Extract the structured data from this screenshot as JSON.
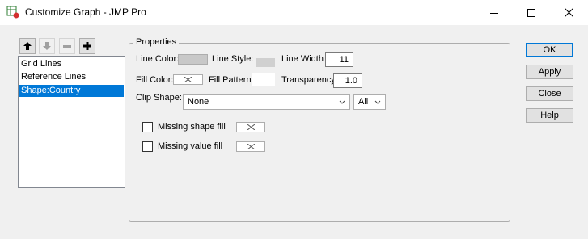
{
  "window": {
    "title": "Customize Graph - JMP Pro",
    "icon": "jmp-app-icon",
    "controls": [
      "minimize-icon",
      "maximize-icon",
      "close-icon"
    ]
  },
  "toolbar": {
    "buttons": [
      {
        "icon": "arrow-up-icon",
        "enabled": true
      },
      {
        "icon": "arrow-down-icon",
        "enabled": false
      },
      {
        "icon": "minus-icon",
        "enabled": false
      },
      {
        "icon": "plus-icon",
        "enabled": true
      }
    ]
  },
  "list": {
    "items": [
      "Grid Lines",
      "Reference Lines",
      "Shape:Country"
    ],
    "selected_index": 2
  },
  "properties": {
    "title": "Properties",
    "line_color_label": "Line Color:",
    "line_color": "#c8c8c8",
    "line_style_label": "Line Style:",
    "line_width_label": "Line Width",
    "line_width": "11",
    "fill_color_label": "Fill Color:",
    "fill_pattern_label": "Fill Pattern",
    "transparency_label": "Transparency",
    "transparency": "1.0",
    "clip_shape_label": "Clip Shape:",
    "clip_shape_value": "None",
    "clip_scope_value": "All",
    "missing_shape_fill_label": "Missing shape fill",
    "missing_shape_fill_checked": false,
    "missing_value_fill_label": "Missing value fill",
    "missing_value_fill_checked": false
  },
  "buttons": {
    "ok": "OK",
    "apply": "Apply",
    "close": "Close",
    "help": "Help"
  },
  "colors": {
    "selection": "#0078d7",
    "swatch_gray": "#c8c8c8"
  }
}
